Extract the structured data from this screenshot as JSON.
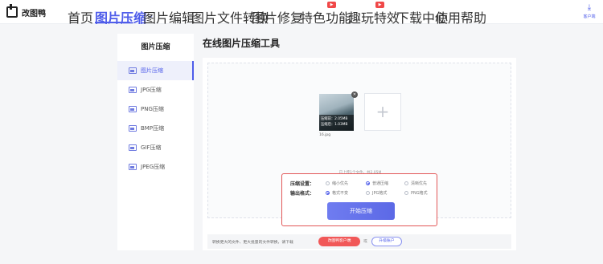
{
  "brand": {
    "name": "改图鸭"
  },
  "nav": {
    "items": [
      {
        "label": "首页"
      },
      {
        "label": "图片压缩"
      },
      {
        "label": "图片编辑"
      },
      {
        "label": "图片文件转换"
      },
      {
        "label": "图片修复"
      },
      {
        "label": "特色功能"
      },
      {
        "label": "趣玩特效"
      },
      {
        "label": "下载中心"
      },
      {
        "label": "使用帮助"
      }
    ],
    "client_label": "客户端",
    "hot_badge": "▶"
  },
  "sidebar": {
    "title": "图片压缩",
    "items": [
      {
        "label": "图片压缩"
      },
      {
        "label": "JPG压缩"
      },
      {
        "label": "PNG压缩"
      },
      {
        "label": "BMP压缩"
      },
      {
        "label": "GIF压缩"
      },
      {
        "label": "JPEG压缩"
      }
    ]
  },
  "main": {
    "title": "在线图片压缩工具",
    "file": {
      "before": "压缩前：2.05MB",
      "after": "压缩后：1.03MB",
      "name": "16.jpg"
    },
    "add_symbol": "+",
    "upload_status": "已上传1个文件，共2.05M",
    "settings": {
      "compress_label": "压缩设置：",
      "compress_options": [
        "缩小优先",
        "普通压缩",
        "清晰优先"
      ],
      "compress_selected": "普通压缩",
      "format_label": "输出格式：",
      "format_options": [
        "格式不变",
        "JPG格式",
        "PNG格式"
      ],
      "format_selected": "格式不变",
      "start_button": "开始压缩"
    },
    "bottom": {
      "text": "转换更大的文件、更大批量的文件转换，请下载",
      "client_button": "改图鸭客户端",
      "or_text": "或",
      "upgrade_button": "升级账户"
    }
  },
  "colors": {
    "accent": "#4f5dea",
    "alert": "#e25757"
  }
}
